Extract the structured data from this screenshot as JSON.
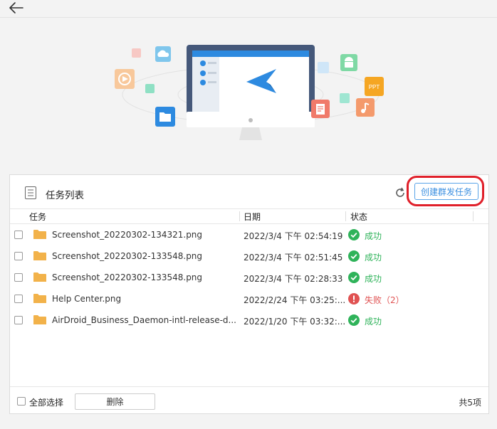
{
  "panel": {
    "title": "任务列表",
    "create_button": "创建群发任务"
  },
  "columns": {
    "task": "任务",
    "date": "日期",
    "status": "状态"
  },
  "rows": [
    {
      "name": "Screenshot_20220302-134321.png",
      "date": "2022/3/4 下午 02:54:19",
      "status": "成功",
      "state": "ok"
    },
    {
      "name": "Screenshot_20220302-133548.png",
      "date": "2022/3/4 下午 02:51:45",
      "status": "成功",
      "state": "ok"
    },
    {
      "name": "Screenshot_20220302-133548.png",
      "date": "2022/3/4 下午 02:28:33",
      "status": "成功",
      "state": "ok"
    },
    {
      "name": "Help Center.png",
      "date": "2022/2/24 下午 03:25:...",
      "status": "失败（2）",
      "state": "fail"
    },
    {
      "name": "AirDroid_Business_Daemon-intl-release-d...",
      "date": "2022/1/20 下午 03:32:...",
      "status": "成功",
      "state": "ok"
    }
  ],
  "footer": {
    "select_all": "全部选择",
    "delete": "删除",
    "total": "共5项"
  },
  "hero": {
    "ppt_label": "PPT"
  },
  "colors": {
    "accent": "#3b8fe0",
    "success": "#2fb35a",
    "fail": "#e05252",
    "highlight": "#e0202a",
    "folder": "#f2b24a"
  }
}
